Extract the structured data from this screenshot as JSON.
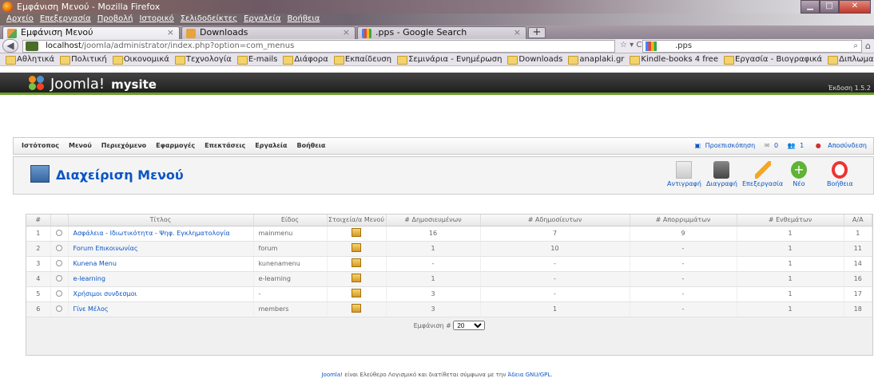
{
  "window": {
    "title": "Εμφάνιση Μενού - Mozilla Firefox"
  },
  "menubar": [
    "Αρχείο",
    "Επεξεργασία",
    "Προβολή",
    "Ιστορικό",
    "Σελιδοδείκτες",
    "Εργαλεία",
    "Βοήθεια"
  ],
  "tabs": [
    {
      "label": "Εμφάνιση Μενού",
      "active": true
    },
    {
      "label": "Downloads",
      "active": false
    },
    {
      "label": ".pps - Google Search",
      "active": false
    }
  ],
  "nav": {
    "url_host": "localhost",
    "url_path": "/joomla/administrator/index.php?option=com_menus",
    "search_value": ".pps"
  },
  "bookmarks": [
    "Αθλητικά",
    "Πολιτική",
    "Οικονομικά",
    "Τεχνολογία",
    "E-mails",
    "Διάφορα",
    "Εκπαίδευση",
    "Σεμινάρια - Ενημέρωση",
    "Downloads",
    "anaplaki.gr",
    "Kindle-books 4 free",
    "Εργασία - Βιογραφικά",
    "Διπλωματική"
  ],
  "joomla": {
    "brand": "Joomla!",
    "site": "mysite",
    "version": "Έκδοση 1.5.2",
    "menu": [
      "Ιστότοπος",
      "Μενού",
      "Περιεχόμενο",
      "Εφαρμογές",
      "Επεκτάσεις",
      "Εργαλεία",
      "Βοήθεια"
    ],
    "status": {
      "preview": "Προεπισκόπηση",
      "messages": "0",
      "users": "1",
      "logout": "Αποσύνδεση"
    },
    "page_title": "Διαχείριση Μενού",
    "toolbar": {
      "copy": "Αντιγραφή",
      "delete": "Διαγραφή",
      "edit": "Επεξεργασία",
      "new": "Νέο",
      "help": "Βοήθεια"
    },
    "columns": [
      "#",
      "",
      "Τίτλος",
      "Είδος",
      "Στοιχεία/α Μενού",
      "# Δημοσιευμένων",
      "# Αδημοσίευτων",
      "# Απορριμμάτων",
      "# Ενθεμάτων",
      "Α/Α"
    ],
    "rows": [
      {
        "n": "1",
        "title": "Ασφάλεια - Ιδιωτικότητα - Ψηφ. Εγκληματολογία",
        "type": "mainmenu",
        "published": "16",
        "unpublished": "7",
        "trash": "9",
        "modules": "1",
        "id": "1"
      },
      {
        "n": "2",
        "title": "Forum Επικοινωνίας",
        "type": "forum",
        "published": "1",
        "unpublished": "10",
        "trash": "-",
        "modules": "1",
        "id": "11"
      },
      {
        "n": "3",
        "title": "Kunena Menu",
        "type": "kunenamenu",
        "published": "-",
        "unpublished": "-",
        "trash": "-",
        "modules": "1",
        "id": "14"
      },
      {
        "n": "4",
        "title": "e-learning",
        "type": "e-learning",
        "published": "1",
        "unpublished": "-",
        "trash": "-",
        "modules": "1",
        "id": "16"
      },
      {
        "n": "5",
        "title": "Χρήσιμοι συνδεσμοι",
        "type": "-",
        "published": "3",
        "unpublished": "-",
        "trash": "-",
        "modules": "1",
        "id": "17"
      },
      {
        "n": "6",
        "title": "Γίνε Μέλος",
        "type": "members",
        "published": "3",
        "unpublished": "1",
        "trash": "-",
        "modules": "1",
        "id": "18"
      }
    ],
    "display_label": "Εμφάνιση #",
    "display_value": "20",
    "footer_prefix": "Joomla!",
    "footer_text": " είναι Ελεύθερο Λογισμικό και διατίθεται σύμφωνα με την ",
    "footer_link": "Άδεια GNU/GPL."
  }
}
